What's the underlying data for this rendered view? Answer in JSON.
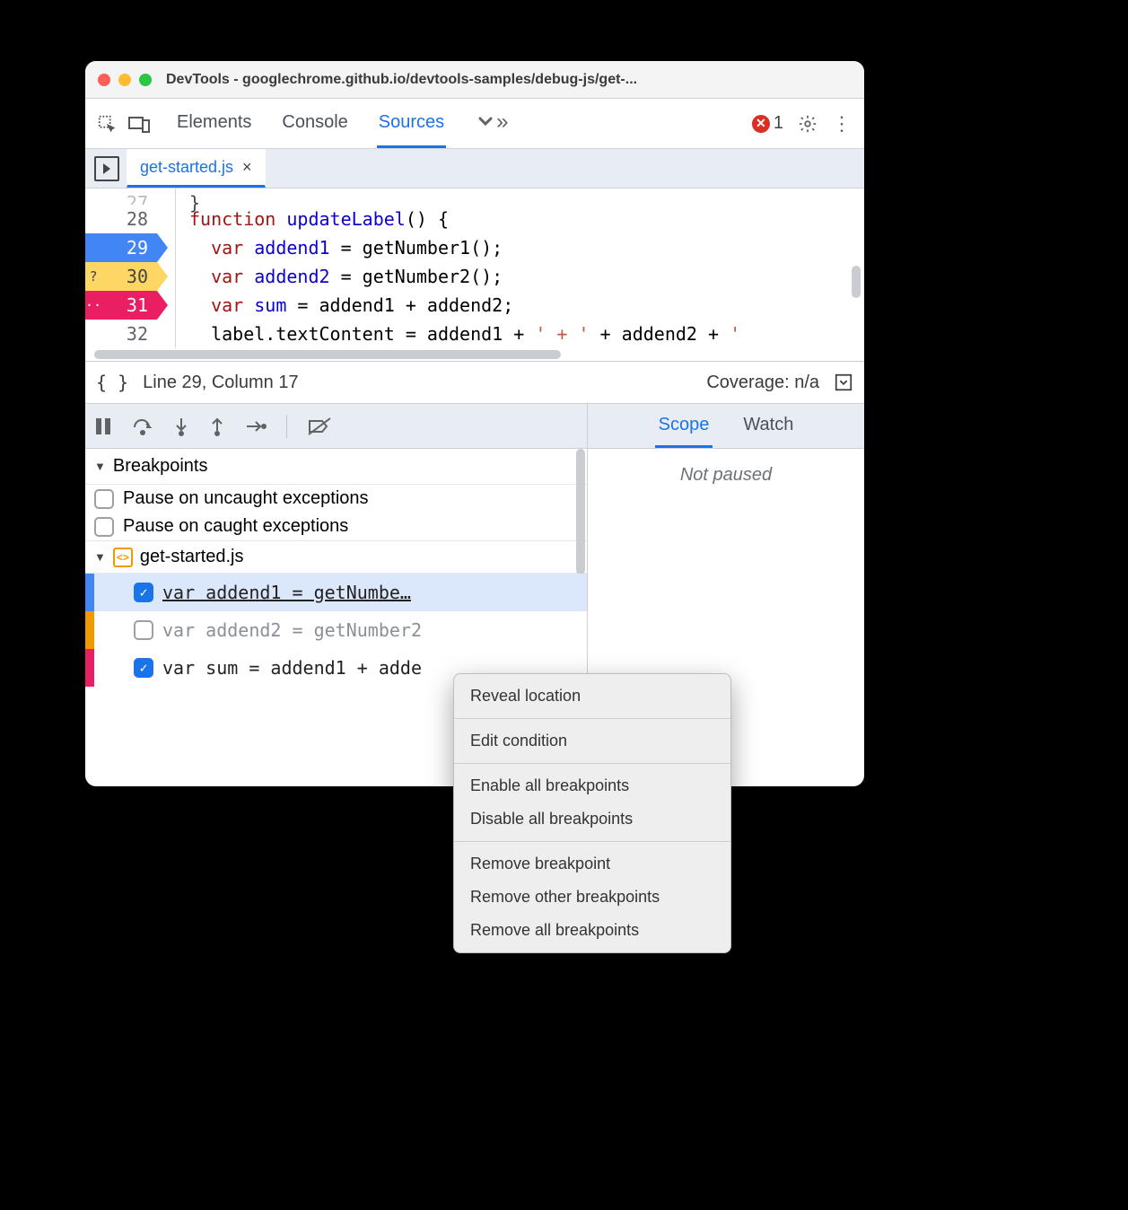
{
  "window": {
    "title_prefix": "DevTools",
    "title_rest": " - googlechrome.github.io/devtools-samples/debug-js/get-..."
  },
  "toolbar": {
    "tabs": {
      "elements": "Elements",
      "console": "Console",
      "sources": "Sources"
    },
    "errors": "1"
  },
  "filetab": {
    "name": "get-started.js",
    "close": "×"
  },
  "code": {
    "lines": [
      {
        "num": "28",
        "gutter": "plain",
        "html_fn": "function ",
        "html_name": "updateLabel",
        "tail": "() {"
      },
      {
        "num": "29",
        "gutter": "blue",
        "kw": "var ",
        "vn": "addend1",
        "tail": " = getNumber1();"
      },
      {
        "num": "30",
        "gutter": "orange",
        "badge": "?",
        "kw": "var ",
        "vn": "addend2",
        "tail": " = getNumber2();"
      },
      {
        "num": "31",
        "gutter": "pink",
        "badge": "··",
        "kw": "var ",
        "vn": "sum",
        "tail": " = addend1 + addend2;"
      },
      {
        "num": "32",
        "gutter": "plain",
        "plain": "label.textContent = addend1 + ",
        "str": "' + '",
        "plain2": " + addend2 + ",
        "str2": "'"
      }
    ]
  },
  "status": {
    "pos": "Line 29, Column 17",
    "coverage": "Coverage: n/a"
  },
  "right": {
    "scope": "Scope",
    "watch": "Watch",
    "not_paused": "Not paused"
  },
  "breakpoints": {
    "title": "Breakpoints",
    "opt_uncaught": "Pause on uncaught exceptions",
    "opt_caught": "Pause on caught exceptions",
    "file": "get-started.js",
    "entries": [
      {
        "marker": "blue",
        "checked": true,
        "selected": true,
        "text": "var addend1 = getNumbe…"
      },
      {
        "marker": "orange",
        "checked": false,
        "dimmed": true,
        "text": "var addend2 = getNumber2"
      },
      {
        "marker": "pink",
        "checked": true,
        "dimmed": false,
        "text": "var sum = addend1 + adde"
      }
    ]
  },
  "ctx": {
    "reveal": "Reveal location",
    "edit": "Edit condition",
    "enable_all": "Enable all breakpoints",
    "disable_all": "Disable all breakpoints",
    "remove": "Remove breakpoint",
    "remove_other": "Remove other breakpoints",
    "remove_all": "Remove all breakpoints"
  }
}
